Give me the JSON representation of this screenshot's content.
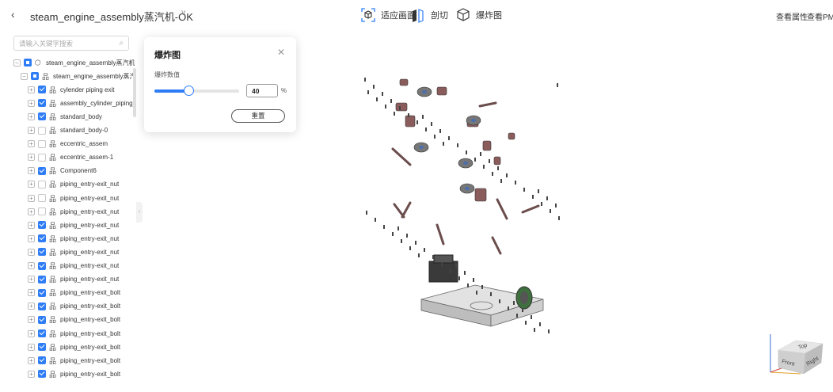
{
  "header": {
    "back_icon": "chevron-left-icon",
    "title": "steam_engine_assembly蒸汽机-OK",
    "tools": [
      {
        "label": "适应画面",
        "icon": "fit-view-icon"
      },
      {
        "label": "剖切",
        "icon": "section-icon"
      },
      {
        "label": "爆炸图",
        "icon": "explode-icon"
      }
    ],
    "right_links": [
      "查看属性",
      "查看PMI"
    ]
  },
  "sidebar": {
    "search_placeholder": "请输入关键字搜索",
    "tree": [
      {
        "label": "steam_engine_assembly蒸汽机-OK",
        "state": "part",
        "level": 0,
        "icon": "assembly-root-icon"
      },
      {
        "label": "steam_engine_assembly蒸汽机",
        "state": "part",
        "level": 1,
        "icon": "assembly-icon"
      },
      {
        "label": "cylender piping exit",
        "state": "on",
        "level": 2,
        "icon": "assembly-icon"
      },
      {
        "label": "assembly_cylinder_piping_e",
        "state": "on",
        "level": 2,
        "icon": "assembly-icon"
      },
      {
        "label": "standard_body",
        "state": "on",
        "level": 2,
        "icon": "assembly-icon"
      },
      {
        "label": "standard_body-0",
        "state": "off",
        "level": 2,
        "icon": "assembly-icon"
      },
      {
        "label": "eccentric_assem",
        "state": "off",
        "level": 2,
        "icon": "assembly-icon"
      },
      {
        "label": "eccentric_assem-1",
        "state": "off",
        "level": 2,
        "icon": "assembly-icon"
      },
      {
        "label": "Component6",
        "state": "on",
        "level": 2,
        "icon": "assembly-icon"
      },
      {
        "label": "piping_entry-exit_nut",
        "state": "off",
        "level": 2,
        "icon": "assembly-icon"
      },
      {
        "label": "piping_entry-exit_nut",
        "state": "off",
        "level": 2,
        "icon": "assembly-icon"
      },
      {
        "label": "piping_entry-exit_nut",
        "state": "off",
        "level": 2,
        "icon": "assembly-icon"
      },
      {
        "label": "piping_entry-exit_nut",
        "state": "on",
        "level": 2,
        "icon": "assembly-icon"
      },
      {
        "label": "piping_entry-exit_nut",
        "state": "on",
        "level": 2,
        "icon": "assembly-icon"
      },
      {
        "label": "piping_entry-exit_nut",
        "state": "on",
        "level": 2,
        "icon": "assembly-icon"
      },
      {
        "label": "piping_entry-exit_nut",
        "state": "on",
        "level": 2,
        "icon": "assembly-icon"
      },
      {
        "label": "piping_entry-exit_nut",
        "state": "on",
        "level": 2,
        "icon": "assembly-icon"
      },
      {
        "label": "piping_entry-exit_bolt",
        "state": "on",
        "level": 2,
        "icon": "assembly-icon"
      },
      {
        "label": "piping_entry-exit_bolt",
        "state": "on",
        "level": 2,
        "icon": "assembly-icon"
      },
      {
        "label": "piping_entry-exit_bolt",
        "state": "on",
        "level": 2,
        "icon": "assembly-icon"
      },
      {
        "label": "piping_entry-exit_bolt",
        "state": "on",
        "level": 2,
        "icon": "assembly-icon"
      },
      {
        "label": "piping_entry-exit_bolt",
        "state": "on",
        "level": 2,
        "icon": "assembly-icon"
      },
      {
        "label": "piping_entry-exit_bolt",
        "state": "on",
        "level": 2,
        "icon": "assembly-icon"
      },
      {
        "label": "piping_entry-exit_bolt",
        "state": "on",
        "level": 2,
        "icon": "assembly-icon"
      }
    ]
  },
  "explode_panel": {
    "title": "爆炸图",
    "label": "爆炸数值",
    "value": "40",
    "value_fraction": 0.4,
    "unit": "%",
    "reset_label": "重置"
  },
  "view_cube": {
    "top": "Top",
    "front": "Front",
    "right": "Right"
  },
  "colors": {
    "accent": "#2f7df6"
  }
}
